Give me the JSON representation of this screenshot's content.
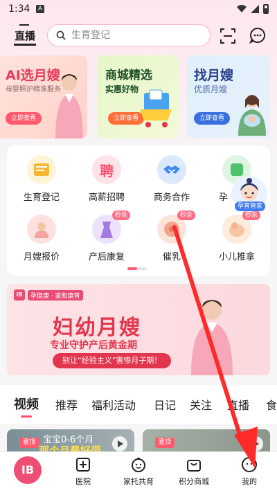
{
  "status_bar": {
    "time": "1:34",
    "notification_icon": "A"
  },
  "header": {
    "live_label": "直播",
    "search_placeholder": "生育登记"
  },
  "promos": [
    {
      "title": "AI选月嫂",
      "subtitle": "母婴照护精准服务",
      "button": "立即查看"
    },
    {
      "title": "商城精选",
      "subtitle": "实惠好物",
      "button": "立即查看"
    },
    {
      "title": "找月嫂",
      "subtitle": "优质月嫂",
      "button": "立即查看"
    }
  ],
  "services": [
    {
      "label": "生育登记",
      "icon": "register-icon",
      "color": "#f7b733"
    },
    {
      "label": "高薪招聘",
      "icon": "recruit-icon",
      "glyph": "聘",
      "color": "#ff6d84"
    },
    {
      "label": "商务合作",
      "icon": "handshake-icon",
      "color": "#3d8bf0"
    },
    {
      "label": "孕",
      "icon": "pregnancy-icon",
      "color": "#4dc26b"
    },
    {
      "label": "月嫂报价",
      "icon": "nanny-price-icon",
      "color": "#f5a3a3"
    },
    {
      "label": "产后康复",
      "icon": "postpartum-icon",
      "color": "#a57be3",
      "badge": "秒杀"
    },
    {
      "label": "催乳",
      "icon": "lactation-icon",
      "color": "#f2a48d",
      "badge": "秒杀"
    },
    {
      "label": "小儿推拿",
      "icon": "baby-massage-icon",
      "color": "#f6c6a3",
      "badge": "秒杀"
    }
  ],
  "assistant": {
    "label": "孕育管家"
  },
  "banner": {
    "brand_mark": "IB",
    "brand_text": "孕健康 · 家和康育",
    "title": "妇幼月嫂",
    "subtitle": "专业守护产后黄金期",
    "pill": "别让“经验主义”害惨月子期！"
  },
  "tabs": [
    "视频",
    "推荐",
    "福利活动",
    "日记",
    "关注",
    "直播",
    "食"
  ],
  "videos": [
    {
      "tag": "置顶",
      "line1": "宝宝0-6个月",
      "line2": "那个月最好带"
    },
    {
      "tag": "置顶",
      "line1": "",
      "line2": ""
    }
  ],
  "bottom_nav": {
    "home_mark": "IB",
    "items": [
      "医院",
      "家托共育",
      "积分商城",
      "我的"
    ]
  },
  "colors": {
    "accent": "#ff4d6d",
    "arrow": "#ff2a2a"
  }
}
